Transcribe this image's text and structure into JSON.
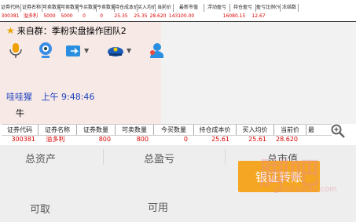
{
  "top_table": {
    "headers": [
      "证券代码",
      "证券名称",
      "可卖数量",
      "可卖数量",
      "今买数量",
      "今卖数量",
      "持仓成本价",
      "买入均价",
      "当前价",
      "最新市值",
      "浮动盈亏",
      "持仓盈亏",
      "盈亏比例(%)",
      "冻结数"
    ],
    "row": [
      "300381",
      "溢多利",
      "5000",
      "5000",
      "0",
      "0",
      "25.35",
      "25.35",
      "28.620",
      "143100.00",
      "",
      "16080.15",
      "12.67",
      ""
    ]
  },
  "chat": {
    "group_title": "来自群：季粉实盘操作团队2",
    "sender": "哇哇猩",
    "time": "上午 9:48:46",
    "message": "牛"
  },
  "table2": {
    "headers": [
      "证券代码",
      "证券名称",
      "证券数量",
      "可卖数量",
      "今买数量",
      "持仓成本价",
      "买入均价",
      "当前价",
      "最"
    ],
    "row": [
      "300381",
      "溢多利",
      "800",
      "800",
      "0",
      "25.61",
      "25.61",
      "28.620",
      ""
    ]
  },
  "bottom": {
    "total_assets": "总资产",
    "total_profit": "总盈亏",
    "total_market_value": "总市值",
    "withdrawable": "可取",
    "available": "可用",
    "transfer_button": "银证转账"
  },
  "watermark": {
    "text": "脚吧",
    "url": "gamf.baidu.com"
  },
  "colors": {
    "accent": "#f5a623",
    "red": "#dd0000",
    "sender_blue": "#1a3fbf"
  },
  "icons": [
    "star-icon",
    "microphone-icon",
    "webcam-icon",
    "share-folder-icon",
    "police-hat-icon",
    "user-icon",
    "magnifier-icon"
  ]
}
